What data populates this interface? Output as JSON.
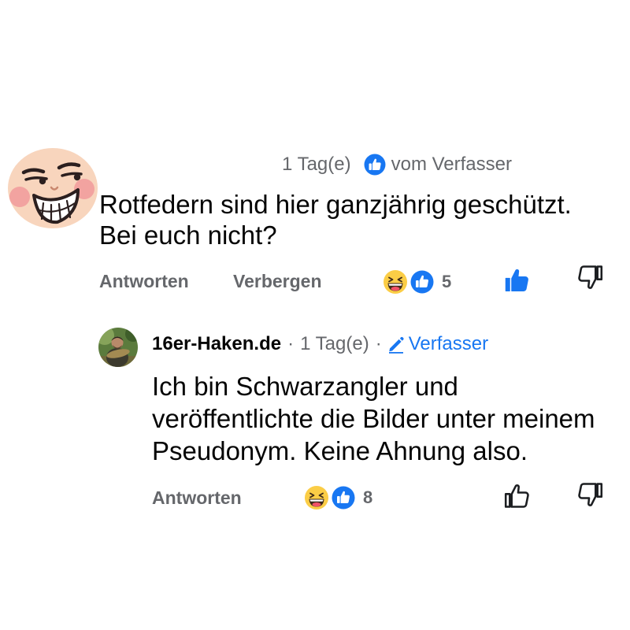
{
  "colors": {
    "text": "#050505",
    "secondary": "#65676b",
    "accent_blue": "#1877f2",
    "icon": "#1c1e21",
    "background": "#ffffff"
  },
  "comment": {
    "avatar_icon": "smirk-face-icon",
    "timestamp": "1 Tag(e)",
    "author_reaction_icon": "like-circle-icon",
    "author_reaction_label": "vom Verfasser",
    "text_lines": [
      "Rotfedern sind hier ganzjährig geschützt.",
      "Bei euch nicht?"
    ],
    "actions": {
      "reply_label": "Antworten",
      "hide_label": "Verbergen"
    },
    "reactions": {
      "icons": [
        "haha-emoji-icon",
        "like-reaction-icon"
      ],
      "count": "5"
    },
    "liked": true,
    "like_icon": "thumbs-up-icon",
    "dislike_icon": "thumbs-down-icon"
  },
  "reply": {
    "avatar_icon": "profile-photo",
    "author": "16er-Haken.de",
    "separator": "·",
    "timestamp": "1 Tag(e)",
    "author_badge_icon": "pencil-icon",
    "author_badge_label": "Verfasser",
    "text_lines": [
      "Ich bin Schwarzangler und",
      "veröffentlichte die Bilder unter meinem",
      "Pseudonym. Keine Ahnung also."
    ],
    "actions": {
      "reply_label": "Antworten"
    },
    "reactions": {
      "icons": [
        "haha-emoji-icon",
        "like-reaction-icon"
      ],
      "count": "8"
    },
    "liked": false,
    "like_icon": "thumbs-up-icon",
    "dislike_icon": "thumbs-down-icon"
  }
}
